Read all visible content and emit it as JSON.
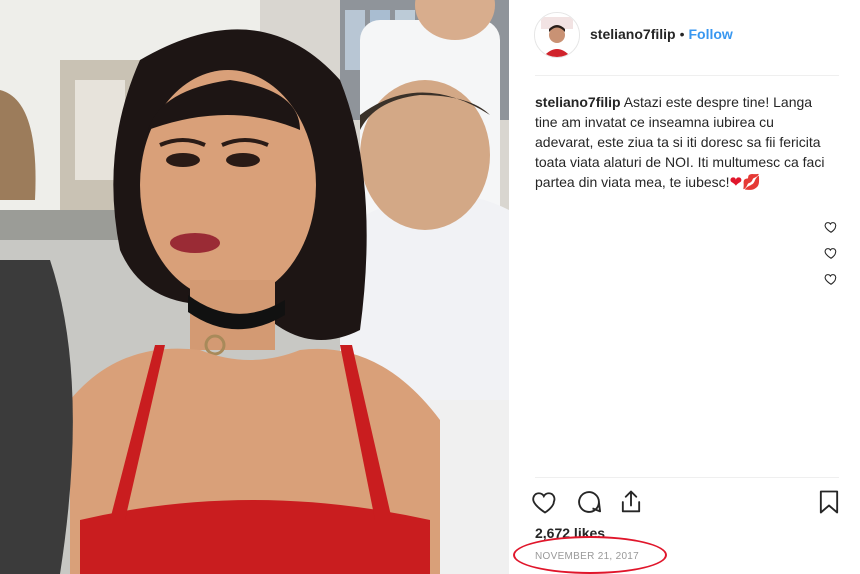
{
  "post": {
    "image_alt": "Photo of a young woman with dark hair in a red top and black choker"
  },
  "header": {
    "username": "steliano7filip",
    "separator": "•",
    "follow_label": "Follow"
  },
  "caption": {
    "username": "steliano7filip",
    "text": "Astazi este despre tine! Langa tine am invatat ce inseamna iubirea cu adevarat, este ziua ta si iti doresc sa fii fericita toata viata alaturi de NOI. Iti multumesc ca faci partea din viata mea, te iubesc!",
    "emojis": "❤💋"
  },
  "comment_like_icons": [
    "heart-outline-icon",
    "heart-outline-icon",
    "heart-outline-icon"
  ],
  "actions": {
    "icons": [
      "heart-outline-icon",
      "comment-icon",
      "share-icon",
      "bookmark-icon"
    ]
  },
  "likes": "2,672 likes",
  "date": "November 21, 2017",
  "colors": {
    "follow": "#3897f0",
    "annotation": "#e0162b",
    "date": "#999999"
  }
}
